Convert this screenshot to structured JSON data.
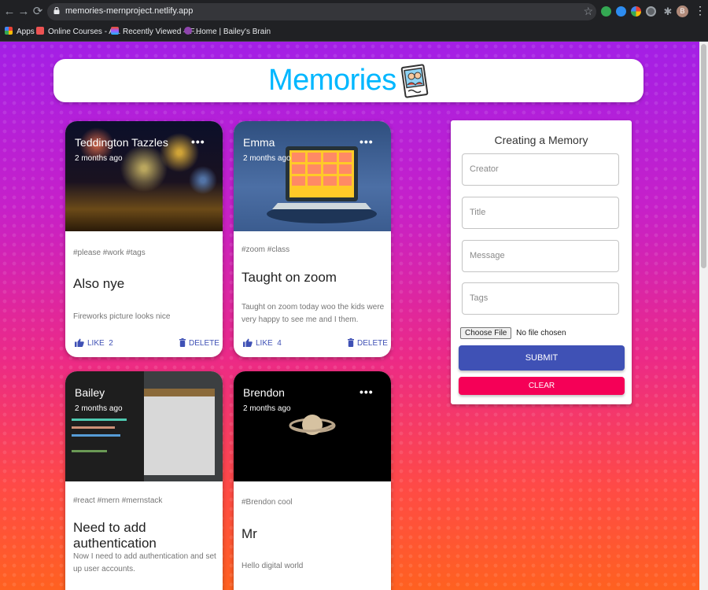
{
  "browser": {
    "url": "memories-mernproject.netlify.app",
    "bookmarks": [
      "Apps",
      "Online Courses - A...",
      "Recently Viewed – F...",
      "Home | Bailey's Brain"
    ],
    "profile_initial": "B"
  },
  "header": {
    "title": "Memories"
  },
  "posts": [
    {
      "creator": "Teddington Tazzles",
      "time": "2 months ago",
      "tags": "#please #work #tags",
      "title": "Also nye",
      "message": "Fireworks picture looks nice",
      "like_label": "LIKE",
      "like_count": "2",
      "delete_label": "DELETE"
    },
    {
      "creator": "Emma",
      "time": "2 months ago",
      "tags": "#zoom #class",
      "title": "Taught on zoom",
      "message": "Taught on zoom today woo the kids were very happy to see me and I them.",
      "like_label": "LIKE",
      "like_count": "4",
      "delete_label": "DELETE"
    },
    {
      "creator": "Bailey",
      "time": "2 months ago",
      "tags": "#react #mern #mernstack",
      "title": "Need to add authentication",
      "message": "Now I need to add authentication and set up user accounts."
    },
    {
      "creator": "Brendon",
      "time": "2 months ago",
      "tags": "#Brendon cool",
      "title": "Mr",
      "message": "Hello digital world"
    }
  ],
  "form": {
    "title": "Creating a Memory",
    "creator_placeholder": "Creator",
    "title_placeholder": "Title",
    "message_placeholder": "Message",
    "tags_placeholder": "Tags",
    "file_button": "Choose File",
    "file_status": "No file chosen",
    "submit_label": "SUBMIT",
    "clear_label": "CLEAR"
  },
  "colors": {
    "brand": "#00b7ff",
    "primary": "#3f51b5",
    "secondary": "#f50057"
  }
}
